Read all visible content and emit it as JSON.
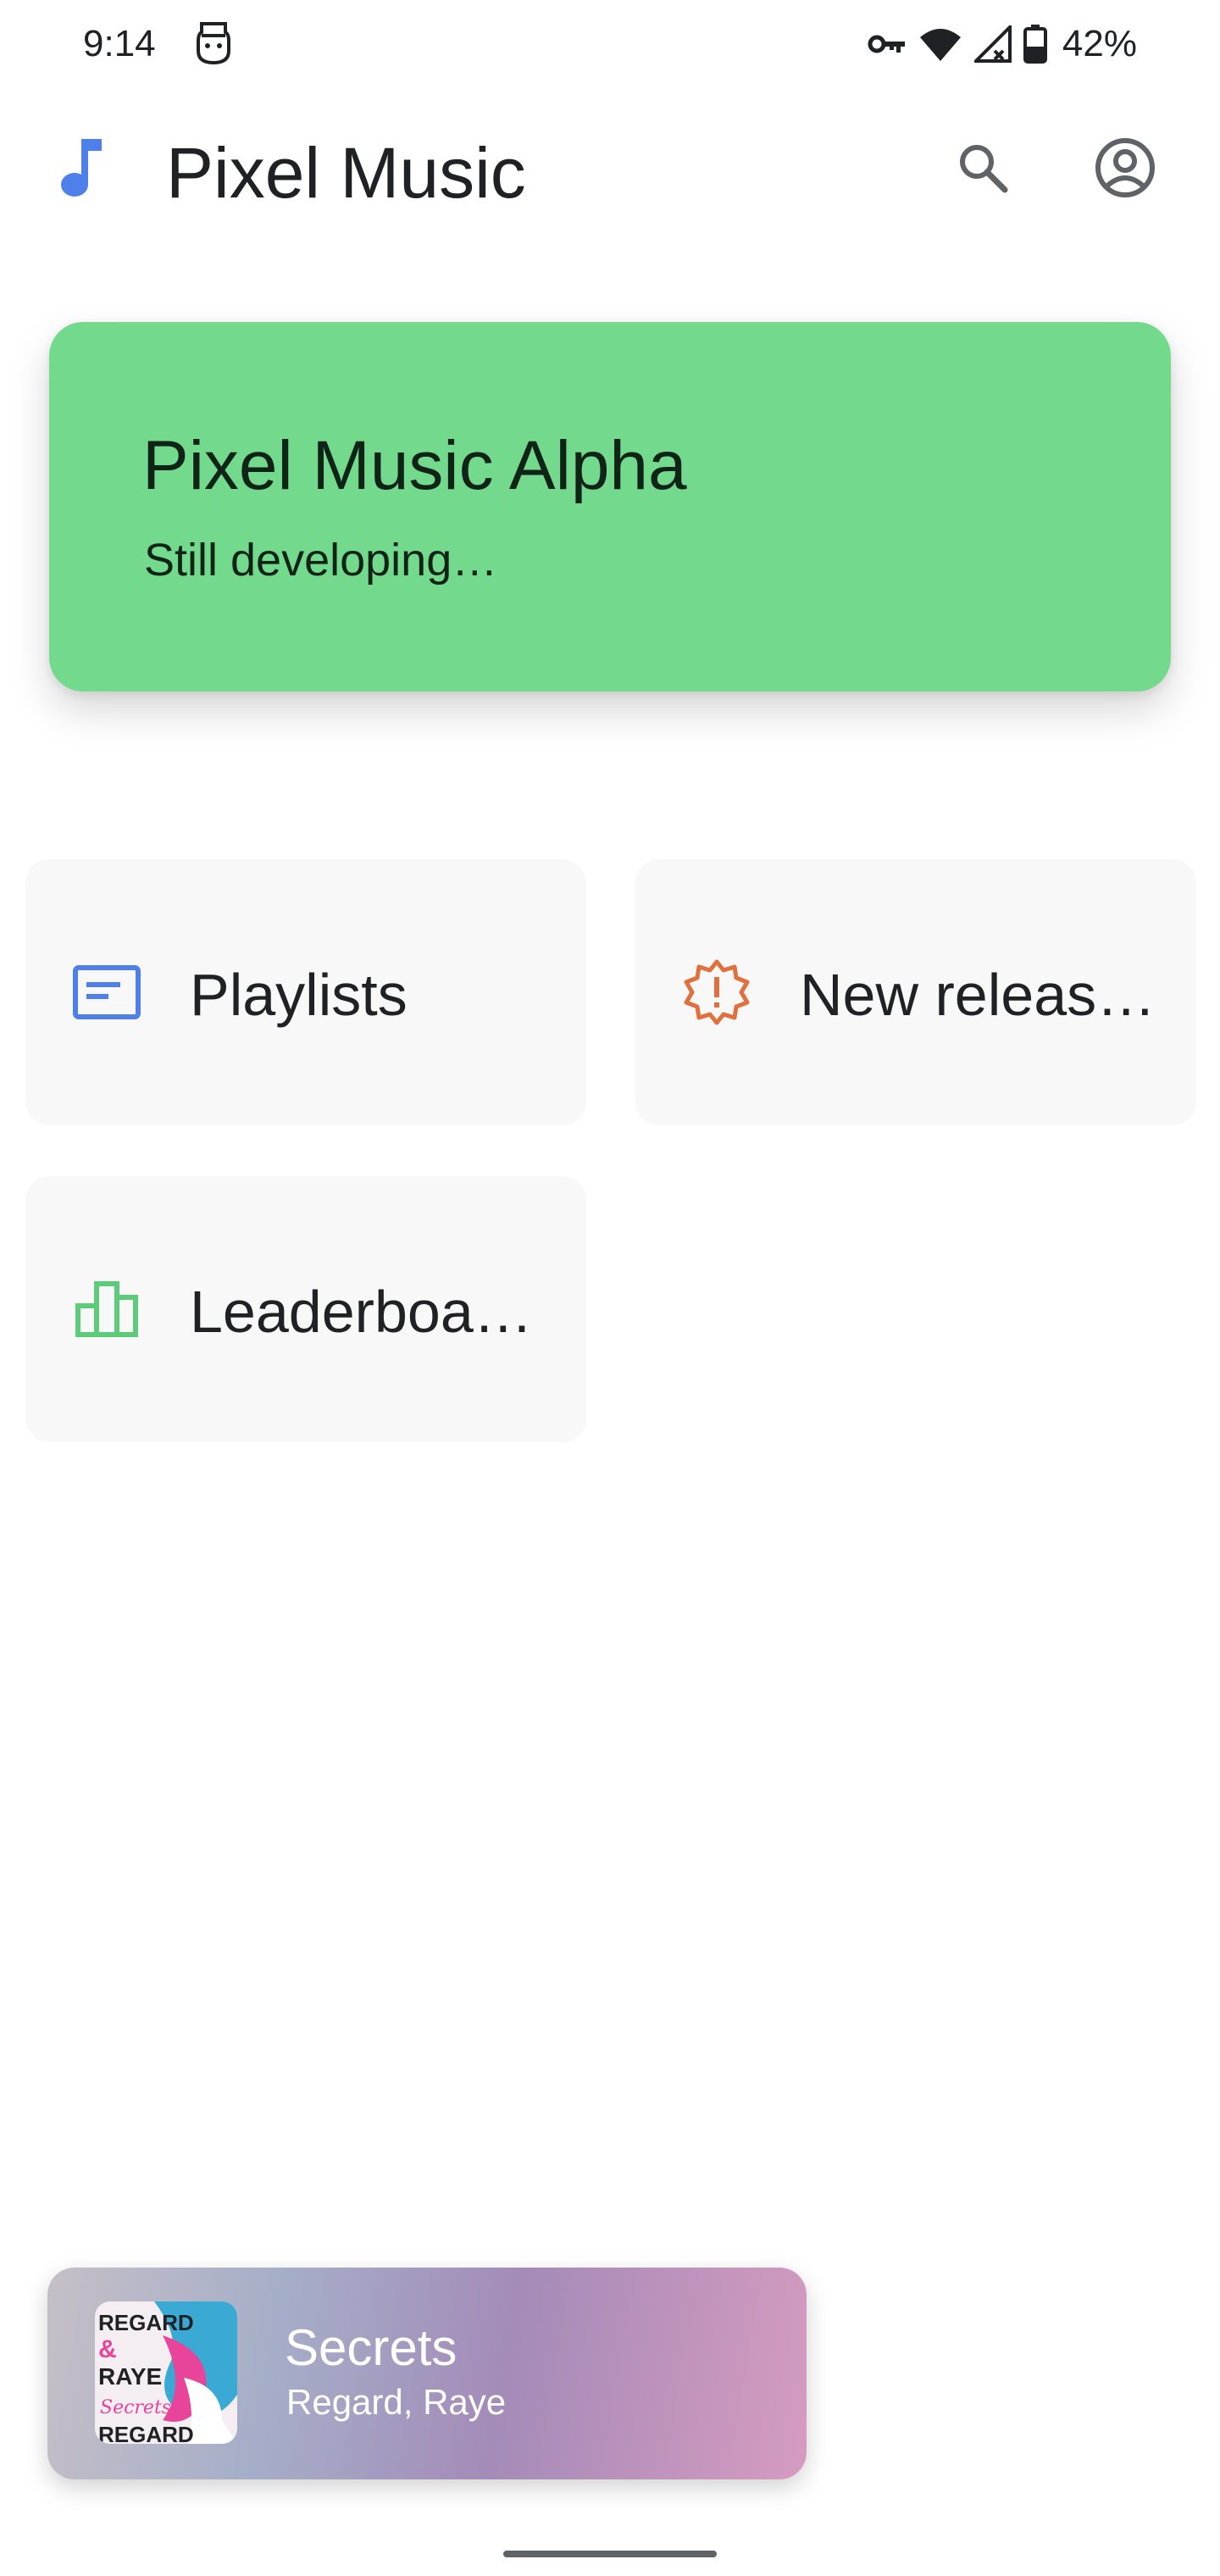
{
  "status_bar": {
    "time": "9:14",
    "battery_percent": "42%",
    "icons": [
      "face-icon",
      "vpn-key-icon",
      "wifi-icon",
      "no-signal-icon",
      "battery-icon"
    ]
  },
  "app_bar": {
    "title": "Pixel Music",
    "logo_icon": "music-note-icon",
    "actions": [
      "search-icon",
      "account-circle-icon"
    ]
  },
  "banner": {
    "title": "Pixel Music Alpha",
    "subtitle": "Still developing…",
    "color": "#73d98c"
  },
  "menu": {
    "items": [
      {
        "label": "Playlists",
        "icon": "playlist-icon",
        "color": "#4f7fe8"
      },
      {
        "label": "New releas…",
        "icon": "new-releases-icon",
        "color": "#e2703f"
      },
      {
        "label": "Leaderboa…",
        "icon": "leaderboard-icon",
        "color": "#5ccc7a"
      }
    ]
  },
  "mini_player": {
    "title": "Secrets",
    "artist": "Regard, Raye",
    "album_art_text": [
      "REGARD",
      "&",
      "RAYE",
      "Secrets",
      "REGARD"
    ]
  }
}
